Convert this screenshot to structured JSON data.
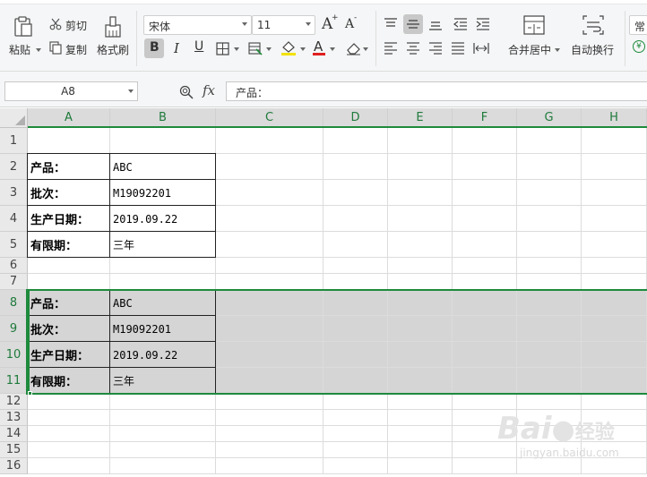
{
  "ribbon": {
    "paste_label": "粘贴",
    "cut_label": "剪切",
    "copy_label": "复制",
    "format_painter_label": "格式刷",
    "font_name": "宋体",
    "font_size": "11",
    "bold_glyph": "B",
    "italic_glyph": "I",
    "underline_glyph": "U",
    "merge_center_label": "合并居中",
    "wrap_text_label": "自动换行",
    "number_format_label": "常",
    "currency_glyph": "¥",
    "increase_font_glyph": "A",
    "decrease_font_glyph": "A"
  },
  "formula_bar": {
    "name_box": "A8",
    "fx_label": "fx",
    "content": "产品："
  },
  "columns": [
    "A",
    "B",
    "C",
    "D",
    "E",
    "F",
    "G",
    "H"
  ],
  "rows": [
    "1",
    "2",
    "3",
    "4",
    "5",
    "6",
    "7",
    "8",
    "9",
    "10",
    "11",
    "12",
    "13",
    "14",
    "15",
    "16"
  ],
  "table1": [
    {
      "label": "产品：",
      "value": "ABC"
    },
    {
      "label": "批次：",
      "value": "M19092201"
    },
    {
      "label": "生产日期：",
      "value": "2019.09.22"
    },
    {
      "label": "有限期：",
      "value": "三年"
    }
  ],
  "table2": [
    {
      "label": "产品：",
      "value": "ABC"
    },
    {
      "label": "批次：",
      "value": "M19092201"
    },
    {
      "label": "生产日期：",
      "value": "2019.09.22"
    },
    {
      "label": "有限期：",
      "value": "三年"
    }
  ],
  "watermark": {
    "brand": "Bai",
    "brand2": "经验",
    "url": "jingyan.baidu.com"
  },
  "colors": {
    "selection_green": "#1e8a3c",
    "selection_fill": "#d5d5d5",
    "header_bg": "#e9e9e9"
  }
}
